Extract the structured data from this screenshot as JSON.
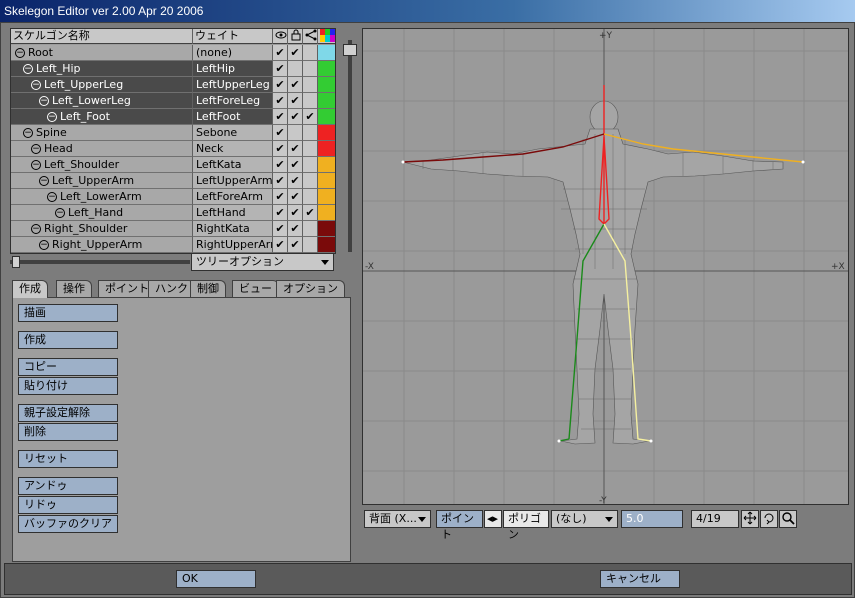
{
  "window": {
    "title": "Skelegon Editor ver 2.00 Apr 20 2006"
  },
  "tree": {
    "headers": {
      "name": "スケルゴン名称",
      "weight": "ウェイト"
    },
    "rows": [
      {
        "name": "Root",
        "indent": 0,
        "weight": "(none)",
        "c1": "✔",
        "c2": "✔",
        "c3": "",
        "color": "#7fd8e8",
        "sel": false
      },
      {
        "name": "Left_Hip",
        "indent": 1,
        "weight": "LeftHip",
        "c1": "✔",
        "c2": "",
        "c3": "",
        "color": "#33cc33",
        "sel": true
      },
      {
        "name": "Left_UpperLeg",
        "indent": 2,
        "weight": "LeftUpperLeg",
        "c1": "✔",
        "c2": "✔",
        "c3": "",
        "color": "#33cc33",
        "sel": true
      },
      {
        "name": "Left_LowerLeg",
        "indent": 3,
        "weight": "LeftForeLeg",
        "c1": "✔",
        "c2": "✔",
        "c3": "",
        "color": "#33cc33",
        "sel": true
      },
      {
        "name": "Left_Foot",
        "indent": 4,
        "weight": "LeftFoot",
        "c1": "✔",
        "c2": "✔",
        "c3": "✔",
        "color": "#33cc33",
        "sel": true
      },
      {
        "name": "Spine",
        "indent": 1,
        "weight": "Sebone",
        "c1": "✔",
        "c2": "",
        "c3": "",
        "color": "#ee2222",
        "sel": false
      },
      {
        "name": "Head",
        "indent": 2,
        "weight": "Neck",
        "c1": "✔",
        "c2": "✔",
        "c3": "",
        "color": "#ee2222",
        "sel": false
      },
      {
        "name": "Left_Shoulder",
        "indent": 2,
        "weight": "LeftKata",
        "c1": "✔",
        "c2": "✔",
        "c3": "",
        "color": "#f0b020",
        "sel": false
      },
      {
        "name": "Left_UpperArm",
        "indent": 3,
        "weight": "LeftUpperArm",
        "c1": "✔",
        "c2": "✔",
        "c3": "",
        "color": "#f0b020",
        "sel": false
      },
      {
        "name": "Left_LowerArm",
        "indent": 4,
        "weight": "LeftForeArm",
        "c1": "✔",
        "c2": "✔",
        "c3": "",
        "color": "#f0b020",
        "sel": false
      },
      {
        "name": "Left_Hand",
        "indent": 5,
        "weight": "LeftHand",
        "c1": "✔",
        "c2": "✔",
        "c3": "✔",
        "color": "#f0b020",
        "sel": false
      },
      {
        "name": "Right_Shoulder",
        "indent": 2,
        "weight": "RightKata",
        "c1": "✔",
        "c2": "✔",
        "c3": "",
        "color": "#7a0a0a",
        "sel": false
      },
      {
        "name": "Right_UpperArm",
        "indent": 3,
        "weight": "RightUpperArm",
        "c1": "✔",
        "c2": "✔",
        "c3": "",
        "color": "#7a0a0a",
        "sel": false
      }
    ],
    "options_label": "ツリーオプション"
  },
  "tabs": [
    "作成",
    "操作",
    "ポイント",
    "ハンク",
    "制御",
    "ビュー",
    "オプション"
  ],
  "commands": {
    "draw": "描画",
    "create": "作成",
    "copy": "コピー",
    "paste": "貼り付け",
    "unparent": "親子設定解除",
    "delete": "削除",
    "reset": "リセット",
    "undo": "アンドゥ",
    "redo": "リドゥ",
    "clear_buffer": "バッファのクリア"
  },
  "viewport": {
    "axis_y_top": "+Y",
    "axis_y_bottom": "-Y",
    "axis_x_left": "-X",
    "axis_x_right": "+X",
    "view_mode": "背面 (X...",
    "point_mode": "ポイント",
    "poly_mode": "ポリゴン",
    "layer_select": "(なし)",
    "value": "5.0",
    "counter": "4/19"
  },
  "buttons": {
    "ok": "OK",
    "cancel": "キャンセル"
  }
}
